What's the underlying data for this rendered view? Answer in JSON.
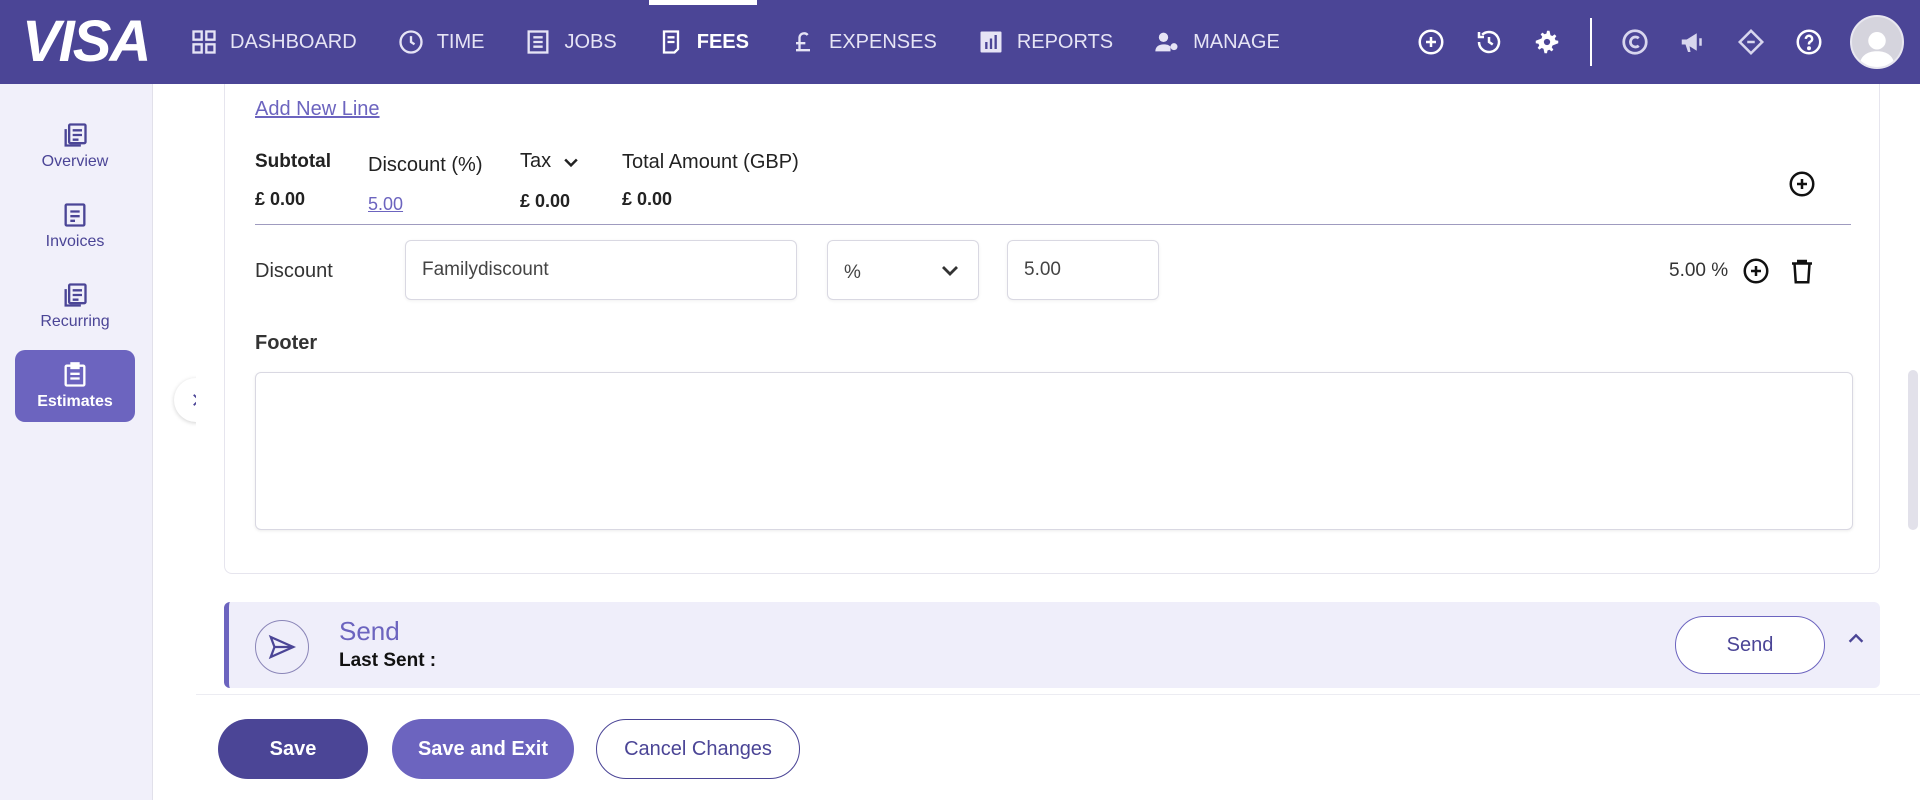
{
  "brand": "VISA",
  "nav": [
    {
      "label": "DASHBOARD",
      "icon": "grid-icon",
      "active": false
    },
    {
      "label": "TIME",
      "icon": "clock-icon",
      "active": false
    },
    {
      "label": "JOBS",
      "icon": "list-icon",
      "active": false
    },
    {
      "label": "FEES",
      "icon": "receipt-icon",
      "active": true
    },
    {
      "label": "EXPENSES",
      "icon": "pound-icon",
      "active": false
    },
    {
      "label": "REPORTS",
      "icon": "bar-chart-icon",
      "active": false
    },
    {
      "label": "MANAGE",
      "icon": "user-gear-icon",
      "active": false
    }
  ],
  "sidebar": {
    "items": [
      {
        "label": "Overview",
        "icon": "document-stack-icon",
        "active": false
      },
      {
        "label": "Invoices",
        "icon": "invoice-icon",
        "active": false
      },
      {
        "label": "Recurring",
        "icon": "recurring-icon",
        "active": false
      },
      {
        "label": "Estimates",
        "icon": "clipboard-icon",
        "active": true
      }
    ]
  },
  "form": {
    "add_new_line": "Add New Line",
    "totals": {
      "subtotal_label": "Subtotal",
      "subtotal_value": "£ 0.00",
      "discount_label": "Discount (%)",
      "discount_value": "5.00",
      "tax_label": "Tax",
      "tax_value": "£ 0.00",
      "total_label": "Total Amount (GBP)",
      "total_value": "£ 0.00"
    },
    "discount_row": {
      "label": "Discount",
      "name_value": "Familydiscount",
      "type_value": "%",
      "amount_value": "5.00",
      "result": "5.00 %"
    },
    "footer_label": "Footer",
    "footer_value": ""
  },
  "send": {
    "title": "Send",
    "last_sent_label": "Last Sent :",
    "button": "Send"
  },
  "actions": {
    "save": "Save",
    "save_exit": "Save and Exit",
    "cancel": "Cancel Changes"
  },
  "colors": {
    "primary": "#4b4596",
    "accent": "#6c64bf"
  }
}
